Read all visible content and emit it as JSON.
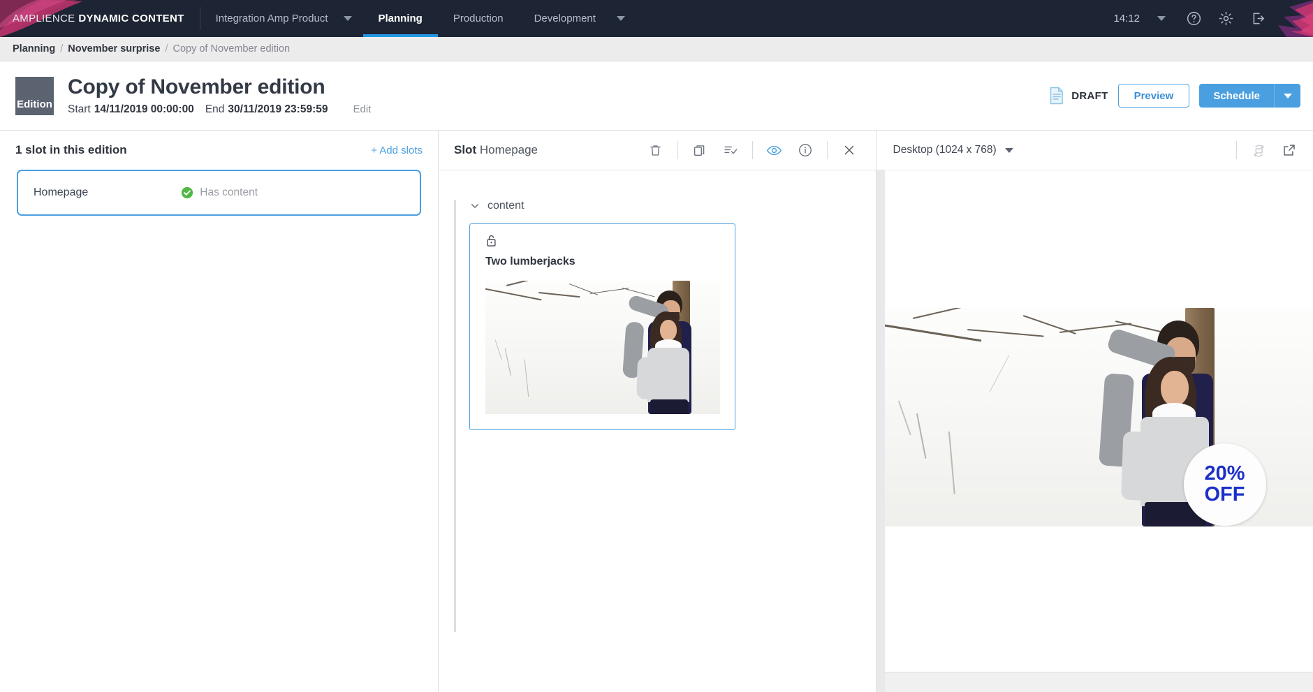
{
  "topnav": {
    "brand_light": "AMPLIENCE",
    "brand_bold": "DYNAMIC CONTENT",
    "product_selector": "Integration Amp Product",
    "items": [
      {
        "label": "Planning",
        "active": true
      },
      {
        "label": "Production",
        "active": false
      },
      {
        "label": "Development",
        "active": false
      }
    ],
    "time": "14:12",
    "icons": [
      "help-icon",
      "gear-icon",
      "logout-icon"
    ]
  },
  "breadcrumb": {
    "items": [
      {
        "label": "Planning",
        "style": "bold"
      },
      {
        "label": "November surprise",
        "style": "bold"
      },
      {
        "label": "Copy of November edition",
        "style": "last"
      }
    ],
    "separator": "/"
  },
  "page_header": {
    "badge": "Edition",
    "title": "Copy of November edition",
    "start_label": "Start",
    "start_value": "14/11/2019 00:00:00",
    "end_label": "End",
    "end_value": "30/11/2019 23:59:59",
    "edit_link": "Edit",
    "status": "DRAFT",
    "preview_button": "Preview",
    "schedule_button": "Schedule",
    "accent_blue": "#4a9fe0",
    "badge_bg": "#5b6270"
  },
  "slots_panel": {
    "heading": "1 slot in this edition",
    "add_slots": "+ Add slots",
    "slots": [
      {
        "name": "Homepage",
        "status": "Has content",
        "status_color": "#52b848",
        "selected": true
      }
    ]
  },
  "slot_detail": {
    "label": "Slot",
    "name": "Homepage",
    "toolbar": [
      {
        "name": "delete-icon",
        "active": false
      },
      {
        "name": "copy-icon",
        "active": false
      },
      {
        "name": "list-check-icon",
        "active": false
      },
      {
        "name": "visibility-eye-icon",
        "active": true
      },
      {
        "name": "info-icon",
        "active": false
      },
      {
        "name": "close-icon",
        "active": false
      }
    ],
    "tree": {
      "group_label": "content",
      "expanded": true,
      "card": {
        "title": "Two lumberjacks",
        "lock_state": "unlocked"
      }
    }
  },
  "preview": {
    "device": "Desktop (1024 x 768)",
    "rotate_icon": "rotate-orientation-icon",
    "popout_icon": "open-external-icon",
    "promo_badge": {
      "line1": "20%",
      "line2": "OFF",
      "text_color": "#1c30c8"
    }
  }
}
